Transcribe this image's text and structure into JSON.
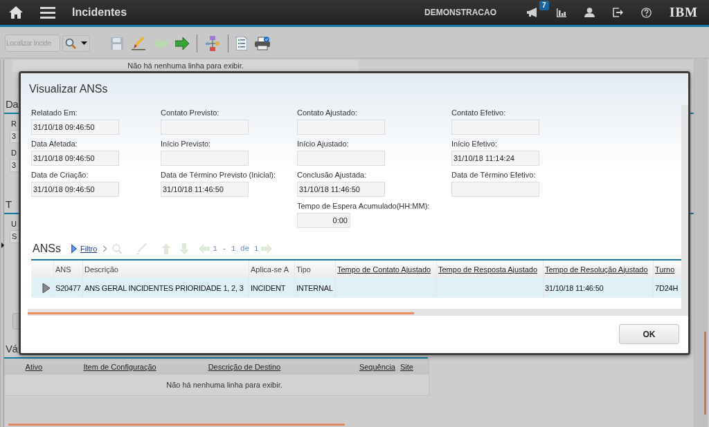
{
  "header": {
    "title": "Incidentes",
    "user": "DEMONSTRACAO",
    "notification_count": "7",
    "brand": "IBM"
  },
  "toolbar": {
    "search": {
      "placeholder": "Localizar Incide"
    }
  },
  "background": {
    "upper_table": {
      "empty_message": "Não há nenhuma linha para exibir."
    },
    "sections": [
      {
        "title": "Da",
        "fields": [
          {
            "label": "R",
            "value": "3"
          },
          {
            "label": "D",
            "value": "3"
          }
        ]
      },
      {
        "title": "T",
        "fields": [
          {
            "label": "U",
            "value": "S"
          }
        ]
      }
    ],
    "lower_section": {
      "title": "Vá",
      "columns": [
        {
          "label": "Ativo",
          "sortable": true
        },
        {
          "label": "Item de Configuração",
          "sortable": true
        },
        {
          "label": "Descrição de Destino",
          "sortable": true
        },
        {
          "label": "Sequência",
          "sortable": true
        },
        {
          "label": "Site",
          "sortable": true
        }
      ],
      "empty_message": "Não há nenhuma linha para exibir."
    }
  },
  "dialog": {
    "title": "Visualizar ANSs",
    "field_columns": [
      [
        {
          "label": "Relatado Em:",
          "value": "31/10/18 09:46:50",
          "kind": "date"
        },
        {
          "label": "Data Afetada:",
          "value": "31/10/18 09:46:50",
          "kind": "date"
        },
        {
          "label": "Data de Criação:",
          "value": "31/10/18 09:46:50",
          "kind": "date"
        }
      ],
      [
        {
          "label": "Contato Previsto:",
          "kind": "date"
        },
        {
          "label": "Início Previsto:",
          "kind": "date"
        },
        {
          "label": "Data de Término Previsto (Inicial):",
          "value": "31/10/18 11:46:50",
          "kind": "date"
        }
      ],
      [
        {
          "label": "Contato Ajustado:",
          "kind": "date"
        },
        {
          "label": "Início Ajustado:",
          "kind": "date"
        },
        {
          "label": "Conclusão Ajustada:",
          "value": "31/10/18 11:46:50",
          "kind": "date"
        },
        {
          "label": "Tempo de Espera Acumulado(HH:MM):",
          "value": "0:00",
          "kind": "duration"
        }
      ],
      [
        {
          "label": "Contato Efetivo:",
          "kind": "date"
        },
        {
          "label": "Início Efetivo:",
          "value": "31/10/18 11:14:24",
          "kind": "date"
        },
        {
          "label": "Data de Término Efetivo:",
          "kind": "date"
        }
      ]
    ],
    "sla_table": {
      "title": "ANSs",
      "filter_label": "Filtro",
      "pager": "1 - 1 de 1",
      "columns": [
        {
          "label": "ANS",
          "sortable": false
        },
        {
          "label": "Descrição",
          "sortable": false
        },
        {
          "label": "Aplica-se A",
          "sortable": false
        },
        {
          "label": "Tipo",
          "sortable": false
        },
        {
          "label": "Tempo de Contato Ajustado",
          "sortable": true
        },
        {
          "label": "Tempo de Resposta Ajustado",
          "sortable": true
        },
        {
          "label": "Tempo de Resolução Ajustado",
          "sortable": true
        },
        {
          "label": "Turno",
          "sortable": true
        }
      ],
      "rows": [
        {
          "selected": true,
          "expanded": false,
          "cells": [
            "S20477",
            "ANS GERAL INCIDENTES PRIORIDADE 1, 2, 3",
            "INCIDENT",
            "INTERNAL",
            null,
            null,
            "31/10/18 11:46:50",
            "7D24H"
          ]
        }
      ]
    },
    "ok_button": {
      "label": "OK"
    }
  }
}
